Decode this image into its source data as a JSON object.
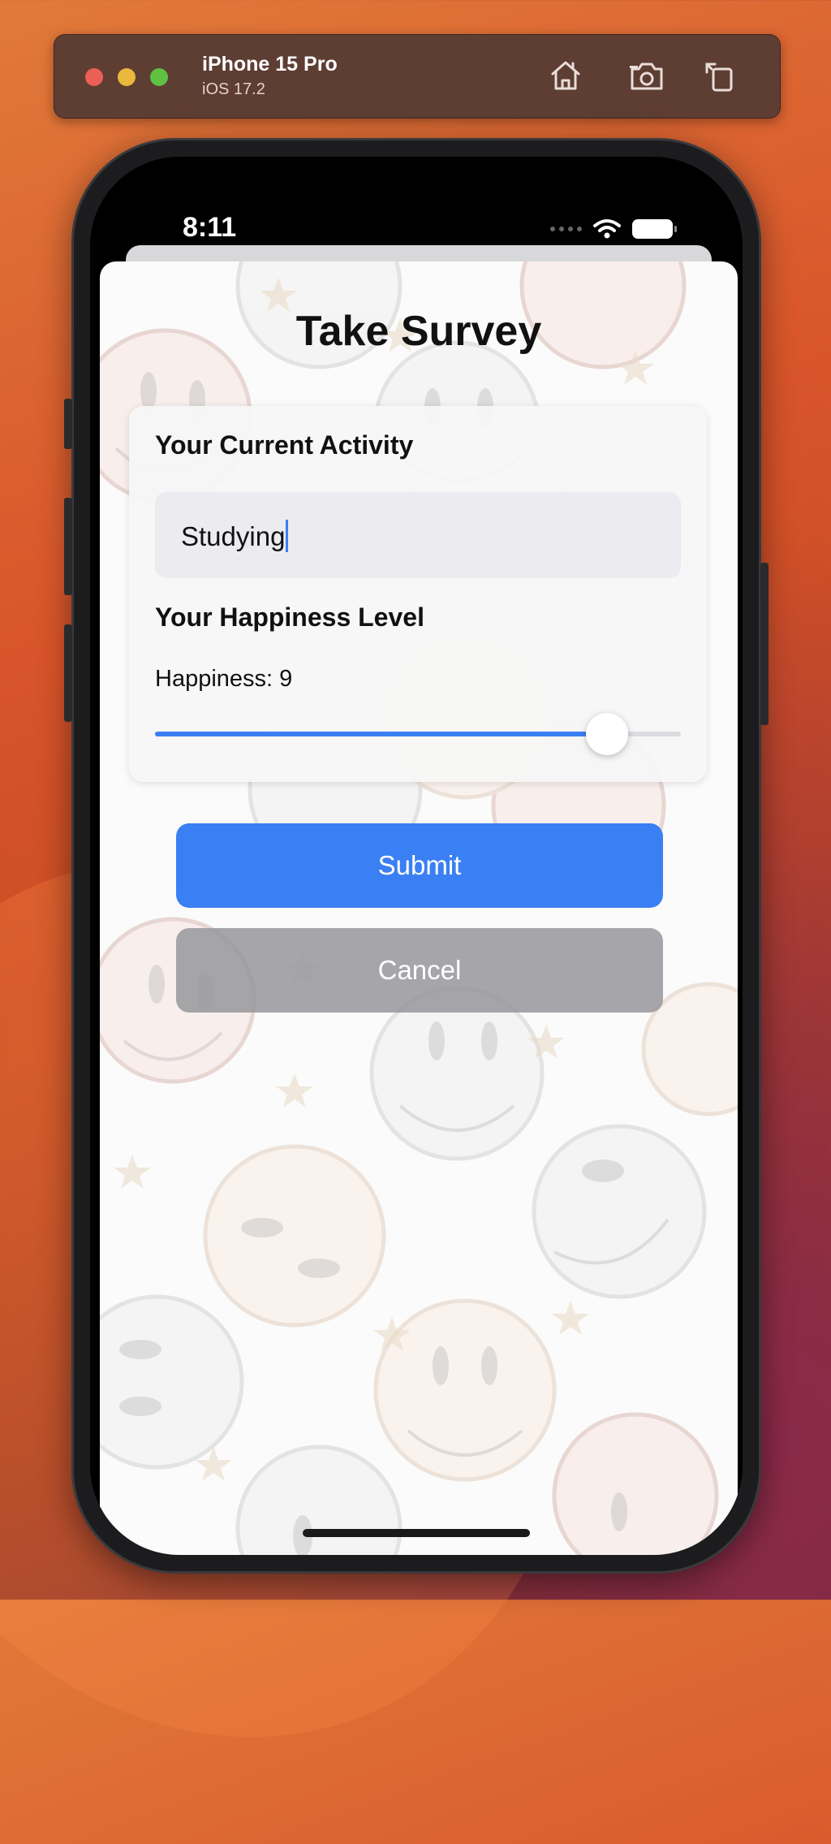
{
  "simulator": {
    "device_name": "iPhone 15 Pro",
    "os_version": "iOS 17.2",
    "icons": [
      "home-icon",
      "screenshot-icon",
      "rotate-icon"
    ]
  },
  "status_bar": {
    "time": "8:11",
    "icons": [
      "signal-dots-icon",
      "wifi-icon",
      "battery-icon"
    ]
  },
  "survey": {
    "title": "Take Survey",
    "activity_heading": "Your Current Activity",
    "activity_value": "Studying",
    "happiness_heading": "Your Happiness Level",
    "happiness_label": "Happiness: 9",
    "happiness_value": 9,
    "happiness_min": 0,
    "happiness_max": 10,
    "submit_label": "Submit",
    "cancel_label": "Cancel"
  },
  "colors": {
    "accent": "#3a7ff4",
    "cancel_button": "#96969b"
  }
}
